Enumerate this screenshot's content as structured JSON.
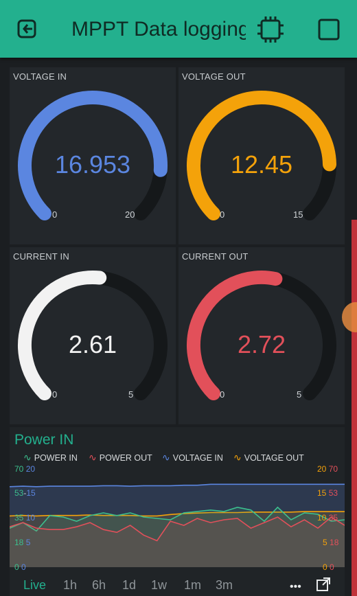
{
  "app": {
    "title": "MPPT Data logging",
    "accent": "#23b08e",
    "icons": {
      "left": "logout-icon",
      "device": "chip-icon",
      "right": "square-icon"
    }
  },
  "gauges": [
    {
      "label": "VOLTAGE IN",
      "value": "16.953",
      "min": "0",
      "max": "20",
      "fraction": 0.848,
      "color": "#5b86e0"
    },
    {
      "label": "VOLTAGE OUT",
      "value": "12.45",
      "min": "0",
      "max": "15",
      "fraction": 0.83,
      "color": "#f4a20a"
    },
    {
      "label": "CURRENT IN",
      "value": "2.61",
      "min": "0",
      "max": "5",
      "fraction": 0.522,
      "color": "#f2f2f2"
    },
    {
      "label": "CURRENT OUT",
      "value": "2.72",
      "min": "0",
      "max": "5",
      "fraction": 0.544,
      "color": "#e2505a"
    }
  ],
  "chart": {
    "title": "Power IN",
    "legend": [
      {
        "label": "POWER IN",
        "color": "#3cbf8e"
      },
      {
        "label": "POWER OUT",
        "color": "#e2505a"
      },
      {
        "label": "VOLTAGE IN",
        "color": "#5b86e0"
      },
      {
        "label": "VOLTAGE OUT",
        "color": "#f4a20a"
      }
    ],
    "left_ticks": [
      {
        "a": "70",
        "b": "20"
      },
      {
        "a": "53",
        "b": "15"
      },
      {
        "a": "35",
        "b": "10"
      },
      {
        "a": "18",
        "b": "5"
      },
      {
        "a": "0",
        "b": "0"
      }
    ],
    "right_ticks": [
      {
        "a": "20",
        "b": "70"
      },
      {
        "a": "15",
        "b": "53"
      },
      {
        "a": "10",
        "b": "35"
      },
      {
        "a": "5",
        "b": "18"
      },
      {
        "a": "0",
        "b": "0"
      }
    ],
    "tabs": [
      "Live",
      "1h",
      "6h",
      "1d",
      "1w",
      "1m",
      "3m"
    ],
    "active_tab": "Live"
  },
  "chart_data": {
    "type": "line",
    "title": "Power IN",
    "x": [
      0,
      1,
      2,
      3,
      4,
      5,
      6,
      7,
      8,
      9,
      10,
      11,
      12,
      13,
      14,
      15,
      16,
      17,
      18,
      19,
      20,
      21,
      22,
      23,
      24,
      25
    ],
    "series": [
      {
        "name": "VOLTAGE IN",
        "axis": "left_secondary",
        "values": [
          16.5,
          16.6,
          16.5,
          16.6,
          16.6,
          16.6,
          16.6,
          16.7,
          16.7,
          16.6,
          16.7,
          16.7,
          16.7,
          16.8,
          16.8,
          17.0,
          17.0,
          17.0,
          17.0,
          17.0,
          17.0,
          17.0,
          17.0,
          17.0,
          17.0,
          17.0
        ]
      },
      {
        "name": "VOLTAGE OUT",
        "axis": "right",
        "values": [
          10.5,
          10.6,
          10.5,
          10.6,
          10.6,
          10.6,
          10.7,
          10.6,
          10.6,
          10.6,
          10.5,
          10.5,
          10.8,
          11.0,
          11.1,
          11.2,
          11.2,
          11.2,
          11.3,
          11.3,
          11.3,
          11.3,
          11.4,
          11.4,
          11.4,
          11.4
        ]
      },
      {
        "name": "POWER IN",
        "axis": "left",
        "values": [
          28,
          32,
          26,
          37,
          36,
          33,
          37,
          39,
          37,
          39,
          36,
          35,
          34,
          39,
          40,
          41,
          40,
          43,
          41,
          33,
          43,
          34,
          39,
          38,
          33,
          34
        ]
      },
      {
        "name": "POWER OUT",
        "axis": "right_secondary",
        "values": [
          29,
          32,
          28,
          27,
          27,
          29,
          32,
          27,
          25,
          30,
          23,
          19,
          33,
          30,
          35,
          32,
          34,
          35,
          28,
          32,
          36,
          29,
          34,
          28,
          36,
          30
        ]
      }
    ],
    "ylim_left": [
      0,
      70
    ],
    "ylim_left_secondary": [
      0,
      20
    ],
    "ylim_right": [
      0,
      20
    ],
    "ylim_right_secondary": [
      0,
      70
    ],
    "grid": false,
    "legend_position": "top"
  }
}
